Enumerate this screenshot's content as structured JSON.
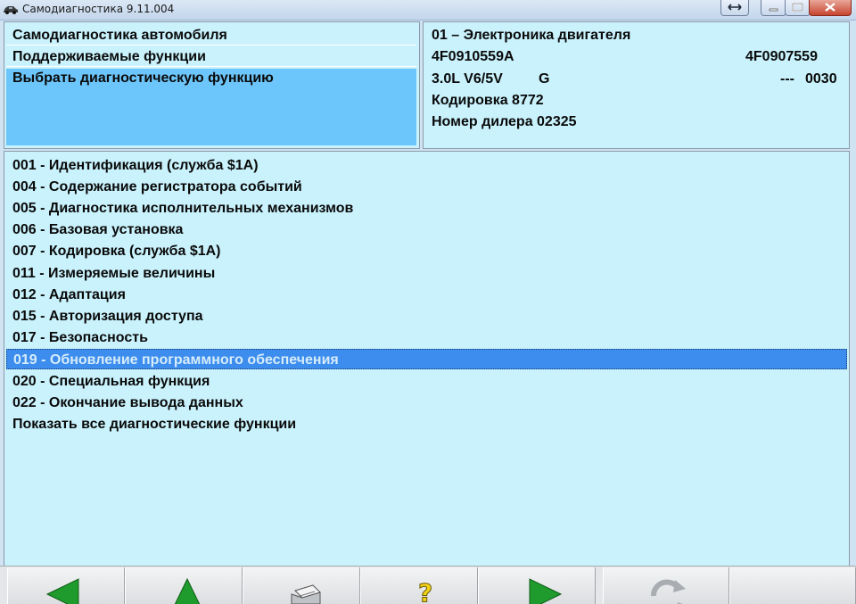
{
  "window": {
    "title": "Самодиагностика 9.11.004"
  },
  "menu": {
    "items": [
      "Самодиагностика автомобиля",
      "Поддерживаемые функции",
      "Выбрать диагностическую функцию"
    ],
    "selected_index": 2
  },
  "module_info": {
    "title": "01 – Электроника двигателя",
    "part_number_left": "4F0910559A",
    "part_number_right": "4F0907559",
    "engine": "3.0L V6/5V",
    "engine_code": "G",
    "version_dashes": "---",
    "version": "0030",
    "coding": "Кодировка 8772",
    "dealer": "Номер дилера 02325"
  },
  "functions": {
    "items": [
      "001 - Идентификация (служба $1A)",
      "004 - Содержание регистратора событий",
      "005 - Диагностика исполнительных механизмов",
      "006 - Базовая установка",
      "007 - Кодировка (служба $1A)",
      "011 - Измеряемые величины",
      "012 - Адаптация",
      "015 - Авторизация доступа",
      "017 - Безопасность",
      "019 - Обновление программного обеспечения",
      "020 - Специальная функция",
      "022 - Окончание вывода данных",
      "Показать все диагностические функции"
    ],
    "selected_index": 9
  },
  "toolbar": {
    "buttons": [
      {
        "name": "back-button",
        "icon": "arrow-left-icon"
      },
      {
        "name": "up-button",
        "icon": "arrow-up-icon"
      },
      {
        "name": "print-button",
        "icon": "printer-icon"
      },
      {
        "name": "help-button",
        "icon": "question-icon"
      },
      {
        "name": "forward-button",
        "icon": "arrow-right-icon"
      },
      {
        "name": "refresh-button",
        "icon": "refresh-icon",
        "disabled": true
      }
    ]
  },
  "colors": {
    "panel_bg": "#c9f2fc",
    "menu_selected": "#6dc6fb",
    "list_selected": "#3c8ded",
    "arrow_green": "#1f9a2c"
  }
}
